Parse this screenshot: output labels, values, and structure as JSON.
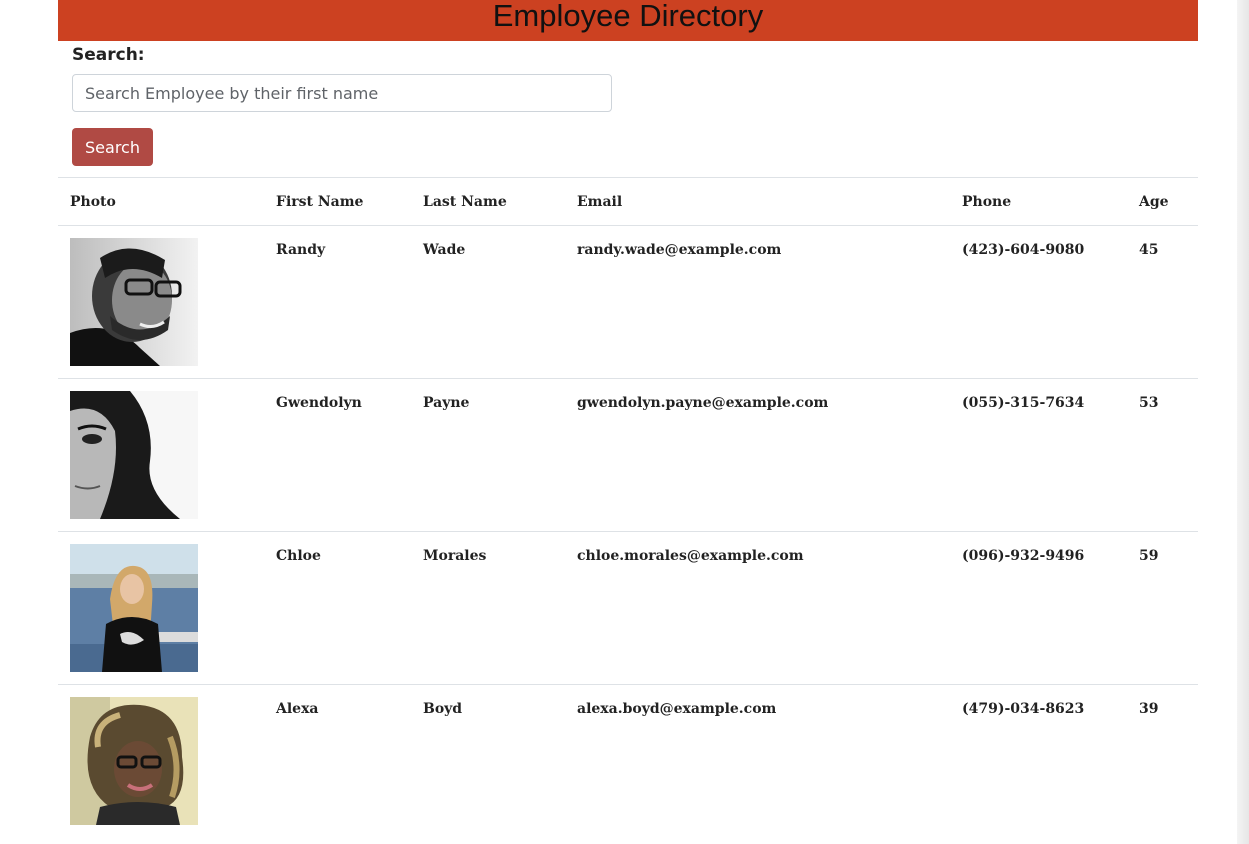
{
  "header": {
    "title": "Employee Directory",
    "bg_color": "#cc4121"
  },
  "search": {
    "label": "Search:",
    "placeholder": "Search Employee by their first name",
    "value": "",
    "button_label": "Search",
    "button_color": "#b04a44"
  },
  "table": {
    "columns": [
      "Photo",
      "First Name",
      "Last Name",
      "Email",
      "Phone",
      "Age"
    ],
    "rows": [
      {
        "photo": "person-photo",
        "first": "Randy",
        "last": "Wade",
        "email": "randy.wade@example.com",
        "phone": "(423)-604-9080",
        "age": "45"
      },
      {
        "photo": "person-photo",
        "first": "Gwendolyn",
        "last": "Payne",
        "email": "gwendolyn.payne@example.com",
        "phone": "(055)-315-7634",
        "age": "53"
      },
      {
        "photo": "person-photo",
        "first": "Chloe",
        "last": "Morales",
        "email": "chloe.morales@example.com",
        "phone": "(096)-932-9496",
        "age": "59"
      },
      {
        "photo": "person-photo",
        "first": "Alexa",
        "last": "Boyd",
        "email": "alexa.boyd@example.com",
        "phone": "(479)-034-8623",
        "age": "39"
      }
    ]
  }
}
